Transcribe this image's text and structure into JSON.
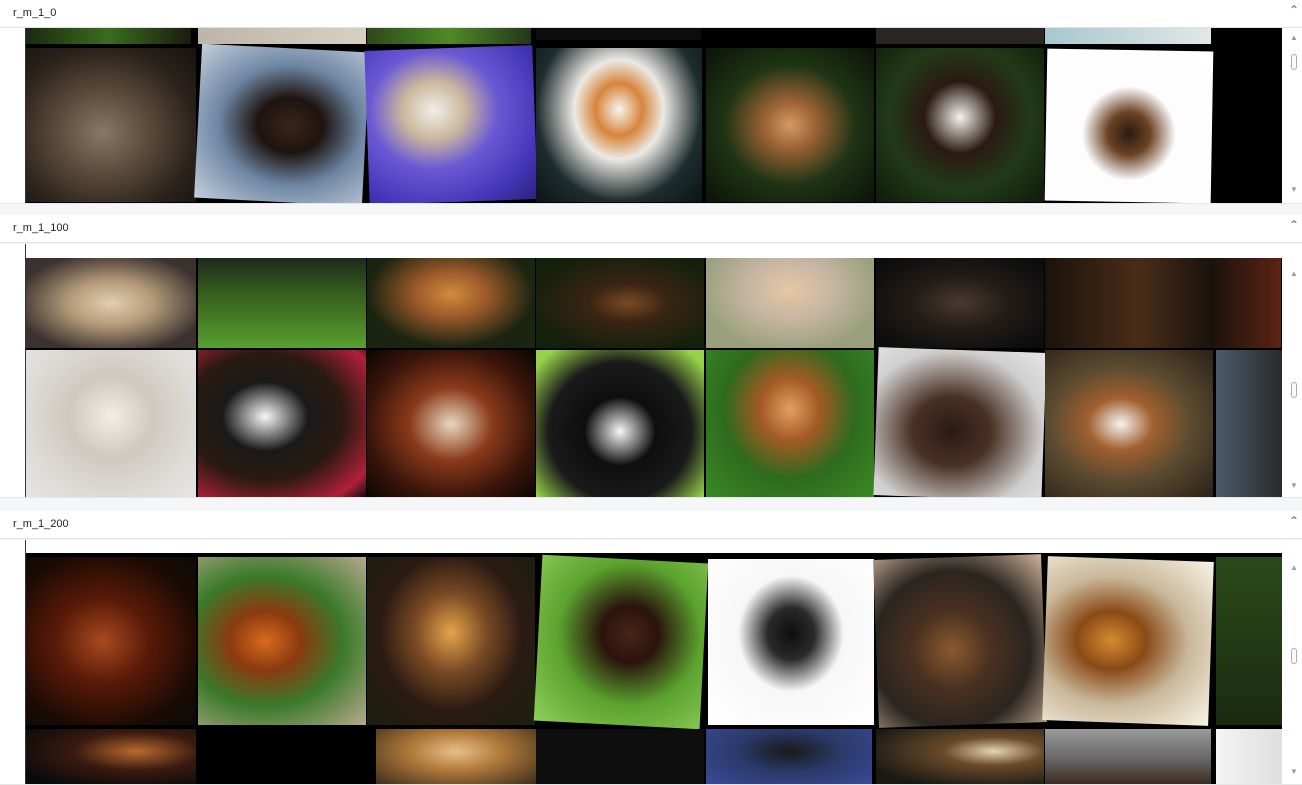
{
  "panels": [
    {
      "title": "r_m_1_0"
    },
    {
      "title": "r_m_1_100"
    },
    {
      "title": "r_m_1_200"
    }
  ],
  "colors": {
    "background": "#f5f6f7",
    "panel_header": "#ffffff",
    "image_grid_bg": "#000000"
  },
  "icons": {
    "collapse": "chevron-up-icon",
    "scroll_up": "triangle-up-icon",
    "scroll_down": "triangle-down-icon"
  }
}
